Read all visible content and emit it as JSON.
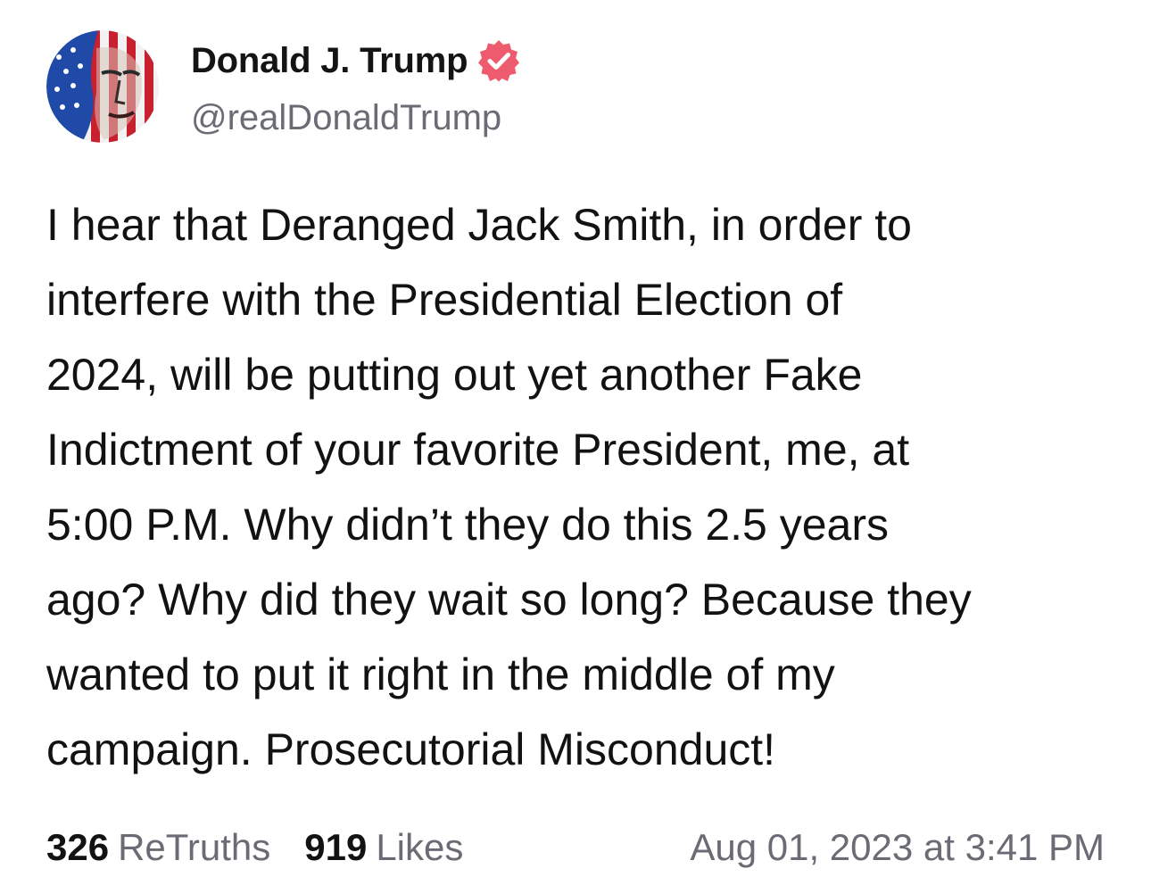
{
  "author": {
    "display_name": "Donald J. Trump",
    "handle": "@realDonaldTrump",
    "verified": true,
    "avatar_icon": "flag-portrait-avatar",
    "verified_icon": "verified-badge-icon",
    "verified_color": "#ee5a6e"
  },
  "post": {
    "lines": [
      "I hear that Deranged Jack Smith, in order to",
      "interfere with the Presidential Election of",
      "2024, will be putting out yet another Fake",
      "Indictment of your favorite President, me, at",
      "5:00 P.M. Why didn’t they do this 2.5 years",
      "ago? Why did they wait so long? Because they",
      "wanted to put it right in the middle of my",
      "campaign. Prosecutorial Misconduct!"
    ]
  },
  "stats": {
    "retruths_count": "326",
    "retruths_label": "ReTruths",
    "likes_count": "919",
    "likes_label": "Likes"
  },
  "timestamp": "Aug 01, 2023 at 3:41 PM",
  "colors": {
    "text_primary": "#121212",
    "text_secondary": "#6b6b75",
    "background": "#ffffff"
  }
}
